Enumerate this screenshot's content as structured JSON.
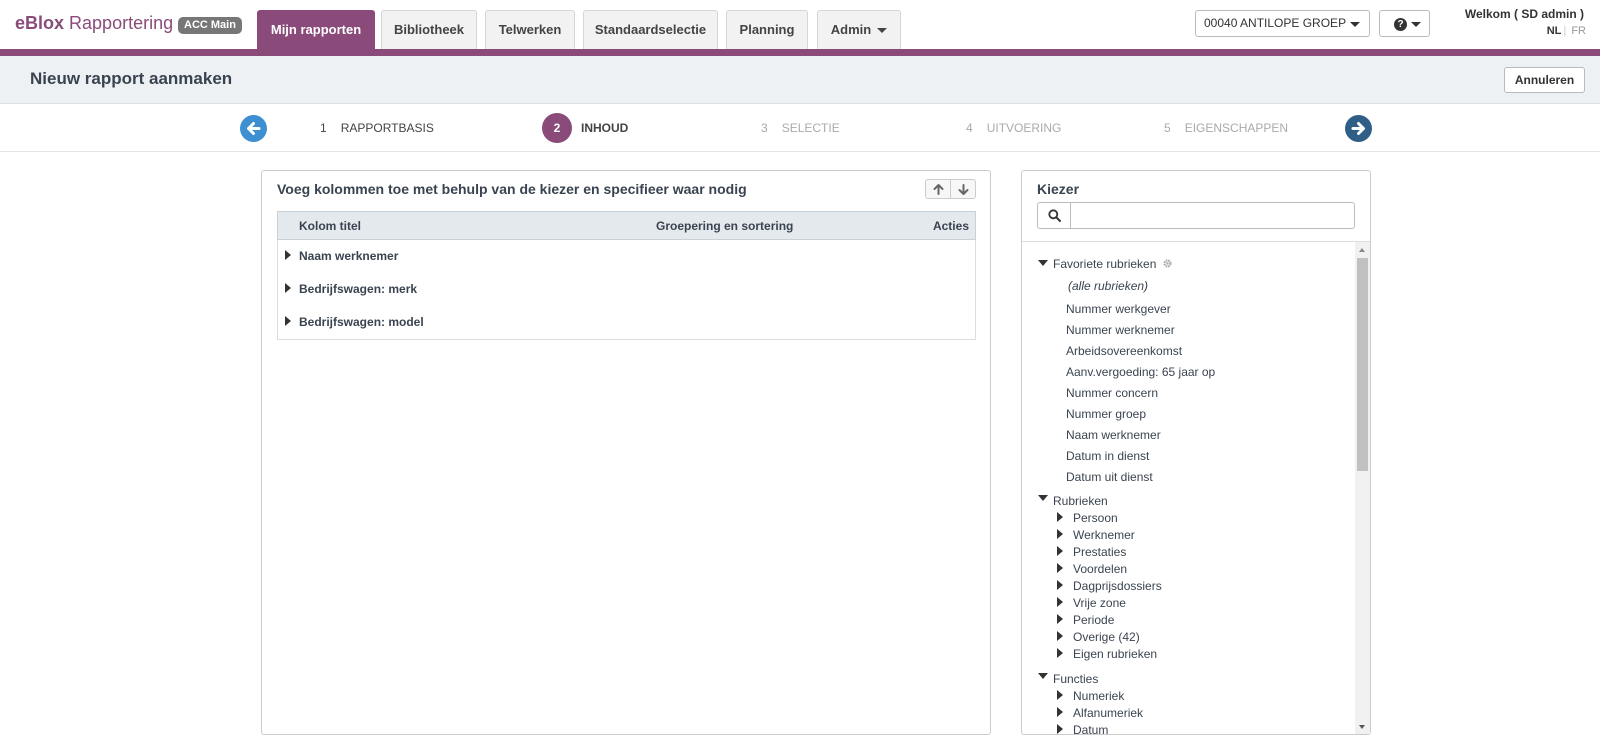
{
  "brand": {
    "bold": "eBlox",
    "rest": " Rapportering",
    "badge": "ACC Main"
  },
  "nav": {
    "tabs": [
      {
        "label": "Mijn rapporten"
      },
      {
        "label": "Bibliotheek"
      },
      {
        "label": "Telwerken"
      },
      {
        "label": "Standaardselectie"
      },
      {
        "label": "Planning"
      },
      {
        "label": "Admin"
      }
    ]
  },
  "colors": {
    "accent": "#8a4b7a",
    "arrow_left": "#3d8fd1",
    "arrow_right": "#2f5f87"
  },
  "company": {
    "selected": "00040 ANTILOPE GROEP"
  },
  "user": {
    "welcome": "Welkom ( SD admin )",
    "lang_nl": "NL",
    "lang_fr": "FR"
  },
  "page": {
    "title": "Nieuw rapport aanmaken",
    "cancel_label": "Annuleren"
  },
  "wizard": {
    "steps": [
      {
        "num": "1",
        "label": "RAPPORTBASIS"
      },
      {
        "num": "2",
        "label": "INHOUD"
      },
      {
        "num": "3",
        "label": "SELECTIE"
      },
      {
        "num": "4",
        "label": "UITVOERING"
      },
      {
        "num": "5",
        "label": "EIGENSCHAPPEN"
      }
    ]
  },
  "columns_panel": {
    "title": "Voeg kolommen toe met behulp van de kiezer en specifieer waar nodig",
    "headers": {
      "title": "Kolom titel",
      "grouping": "Groepering en sortering",
      "actions": "Acties"
    },
    "rows": [
      {
        "label": "Naam werknemer"
      },
      {
        "label": "Bedrijfswagen: merk"
      },
      {
        "label": "Bedrijfswagen: model"
      }
    ]
  },
  "kiezer": {
    "title": "Kiezer",
    "search_value": "",
    "favorites": {
      "label": "Favoriete rubrieken",
      "all_label": "(alle rubrieken)",
      "items": [
        "Nummer werkgever",
        "Nummer werknemer",
        "Arbeidsovereenkomst",
        "Aanv.vergoeding: 65 jaar op",
        "Nummer concern",
        "Nummer groep",
        "Naam werknemer",
        "Datum in dienst",
        "Datum uit dienst"
      ]
    },
    "rubrieken": {
      "label": "Rubrieken",
      "items": [
        "Persoon",
        "Werknemer",
        "Prestaties",
        "Voordelen",
        "Dagprijsdossiers",
        "Vrije zone",
        "Periode",
        "Overige (42)",
        "Eigen rubrieken"
      ]
    },
    "functies": {
      "label": "Functies",
      "items": [
        "Numeriek",
        "Alfanumeriek",
        "Datum"
      ]
    }
  }
}
